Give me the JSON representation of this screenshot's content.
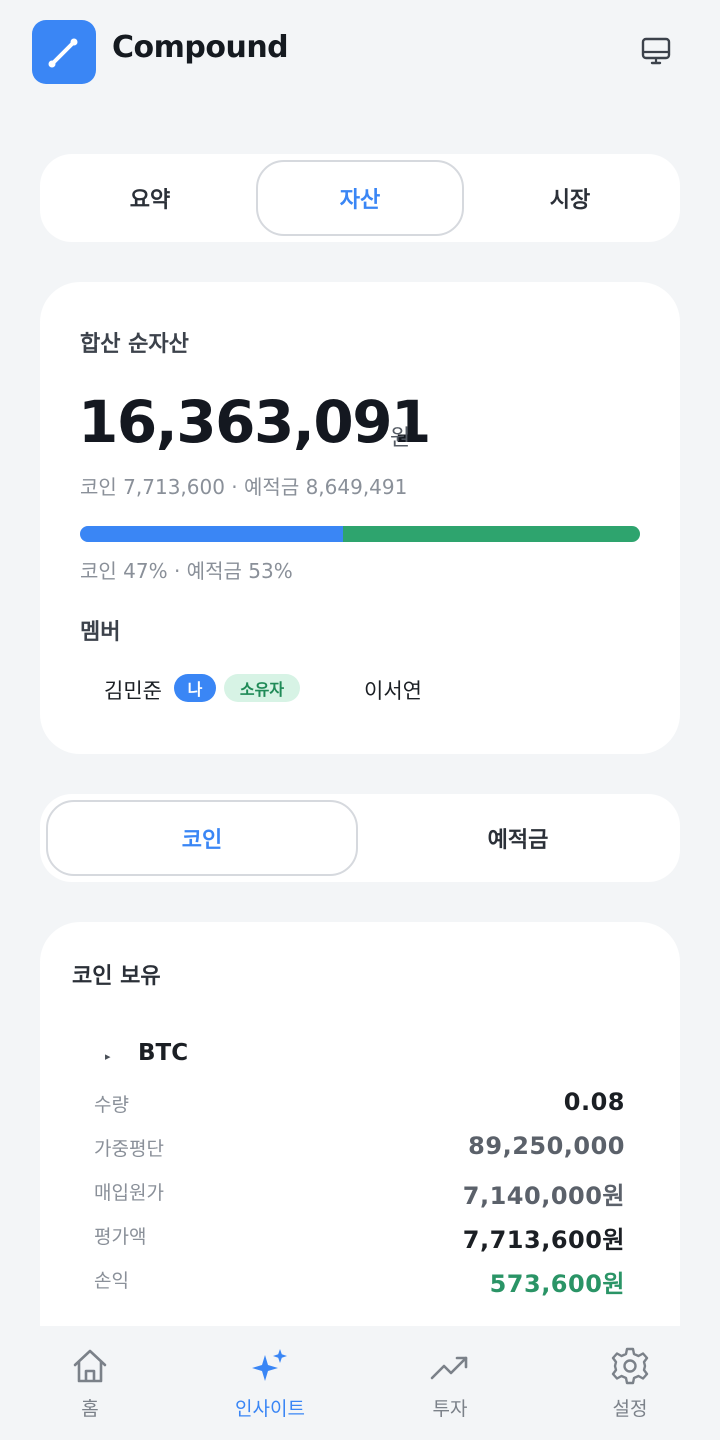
{
  "app": {
    "brand": "Compound"
  },
  "top_tabs": {
    "summary": "요약",
    "assets": "자산",
    "market": "시장"
  },
  "summary_card": {
    "title": "합산 순자산",
    "total": "16,363,091",
    "unit": "원",
    "breakdown": "코인 7,713,600 · 예적금 8,649,491",
    "ratio_text": "코인 47% · 예적금 53%",
    "coin_ratio": 0.47,
    "deposit_ratio": 0.53,
    "members_label": "멤버",
    "members": [
      {
        "name": "김민준",
        "me_badge": "나",
        "role_badge": "소유자"
      },
      {
        "name": "이서연"
      }
    ]
  },
  "asset_tabs": {
    "coin": "코인",
    "deposit": "예적금"
  },
  "holdings": {
    "title": "코인 보유",
    "items": [
      {
        "symbol": "BTC",
        "rows": [
          {
            "label": "수량",
            "value": "0.08"
          },
          {
            "label": "가중평단",
            "value": "89,250,000"
          },
          {
            "label": "매입원가",
            "value": "7,140,000원"
          },
          {
            "label": "평가액",
            "value": "7,713,600원"
          },
          {
            "label": "손익",
            "value": "573,600원"
          }
        ]
      }
    ]
  },
  "bottom_nav": {
    "home": "홈",
    "insight": "인사이트",
    "invest": "투자",
    "settings": "설정"
  },
  "colors": {
    "accent": "#3a86f5",
    "coin_bar": "#3a86f5",
    "deposit_bar": "#2ea46e",
    "profit": "#2a9466"
  }
}
